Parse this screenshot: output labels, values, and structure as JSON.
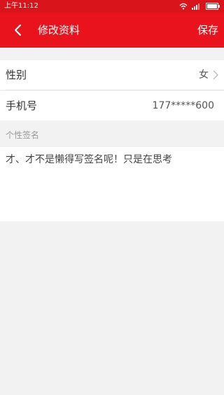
{
  "status_bar": {
    "time": "上午11:12"
  },
  "header": {
    "title": "修改资料",
    "save_label": "保存",
    "accent_color": "#e8131c"
  },
  "profile": {
    "gender": {
      "label": "性别",
      "value": "女"
    },
    "phone": {
      "label": "手机号",
      "value": "177*****600"
    }
  },
  "signature_section": {
    "title": "个性签名",
    "text": "才、才不是懒得写签名呢！只是在思考"
  },
  "icons": [
    "back-arrow-icon",
    "chevron-right-icon",
    "wifi-icon",
    "signal-icon",
    "battery-icon"
  ]
}
